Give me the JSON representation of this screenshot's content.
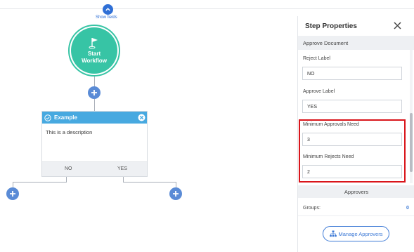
{
  "canvas": {
    "show_fields_label": "Show fields",
    "start_node": {
      "line1": "Start",
      "line2": "Workflow"
    },
    "step_card": {
      "title": "Example",
      "description": "This is a description",
      "branch_no": "NO",
      "branch_yes": "YES"
    }
  },
  "panel": {
    "title": "Step Properties",
    "section": "Approve Document",
    "fields": {
      "reject_label": {
        "label": "Reject Label",
        "value": "NO"
      },
      "approve_label": {
        "label": "Approve Label",
        "value": "YES"
      },
      "min_approvals": {
        "label": "Minimum Approvals Need",
        "value": "3"
      },
      "min_rejects": {
        "label": "Minimum Rejects Need",
        "value": "2"
      }
    },
    "approvers": {
      "header": "Approvers",
      "groups_label": "Groups:",
      "groups_count": "0",
      "manage_button": "Manage Approvers"
    }
  },
  "colors": {
    "start_node": "#37c4a5",
    "card_header": "#47a9e0",
    "accent_blue": "#2f6fd6",
    "highlight_red": "#d9141a"
  }
}
